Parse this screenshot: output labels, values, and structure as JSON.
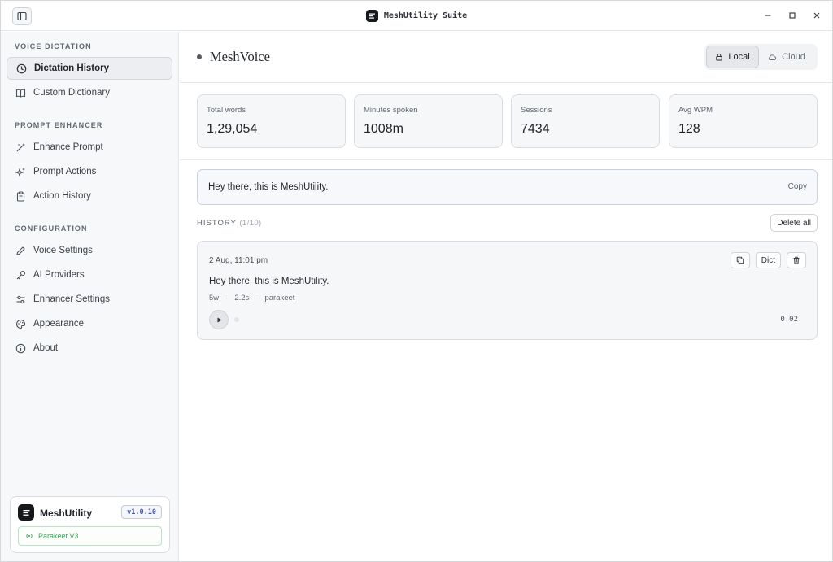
{
  "window": {
    "title": "MeshUtility Suite",
    "icons": {
      "toggle": "sidebar-toggle-icon",
      "minimize": "minimize-icon",
      "maximize": "maximize-icon",
      "close": "close-icon"
    }
  },
  "sidebar": {
    "sections": [
      {
        "label": "VOICE DICTATION",
        "items": [
          {
            "label": "Dictation History",
            "icon": "clock-icon",
            "active": true
          },
          {
            "label": "Custom Dictionary",
            "icon": "book-icon",
            "active": false
          }
        ]
      },
      {
        "label": "PROMPT ENHANCER",
        "items": [
          {
            "label": "Enhance Prompt",
            "icon": "magic-wand-icon",
            "active": false
          },
          {
            "label": "Prompt Actions",
            "icon": "sparkles-icon",
            "active": false
          },
          {
            "label": "Action History",
            "icon": "clipboard-icon",
            "active": false
          }
        ]
      },
      {
        "label": "CONFIGURATION",
        "items": [
          {
            "label": "Voice Settings",
            "icon": "pen-icon",
            "active": false
          },
          {
            "label": "AI Providers",
            "icon": "key-icon",
            "active": false
          },
          {
            "label": "Enhancer Settings",
            "icon": "sliders-icon",
            "active": false
          },
          {
            "label": "Appearance",
            "icon": "palette-icon",
            "active": false
          },
          {
            "label": "About",
            "icon": "info-icon",
            "active": false
          }
        ]
      }
    ],
    "footer": {
      "app_name": "MeshUtility",
      "version": "v1.0.10",
      "model": "Parakeet V3",
      "model_color": "#39a655"
    }
  },
  "header": {
    "brand": "MeshVoice",
    "mode_local": "Local",
    "mode_cloud": "Cloud",
    "selected_mode": "Local"
  },
  "stats": [
    {
      "label": "Total words",
      "value": "1,29,054"
    },
    {
      "label": "Minutes spoken",
      "value": "1008m"
    },
    {
      "label": "Sessions",
      "value": "7434"
    },
    {
      "label": "Avg WPM",
      "value": "128"
    }
  ],
  "latest": {
    "text": "Hey there, this is MeshUtility.",
    "copy_label": "Copy"
  },
  "history": {
    "label": "HISTORY",
    "count": "(1/10)",
    "delete_all_label": "Delete all",
    "entries": [
      {
        "date": "2 Aug, 11:01 pm",
        "text": "Hey there, this is MeshUtility.",
        "words": "5w",
        "duration_s": "2.2s",
        "model": "parakeet",
        "playback": "0:02",
        "dict_label": "Dict"
      }
    ]
  },
  "colors": {
    "accent": "#4a5aa8",
    "success": "#39a655",
    "border": "#d9dce0",
    "card_bg": "#f6f7f9"
  }
}
